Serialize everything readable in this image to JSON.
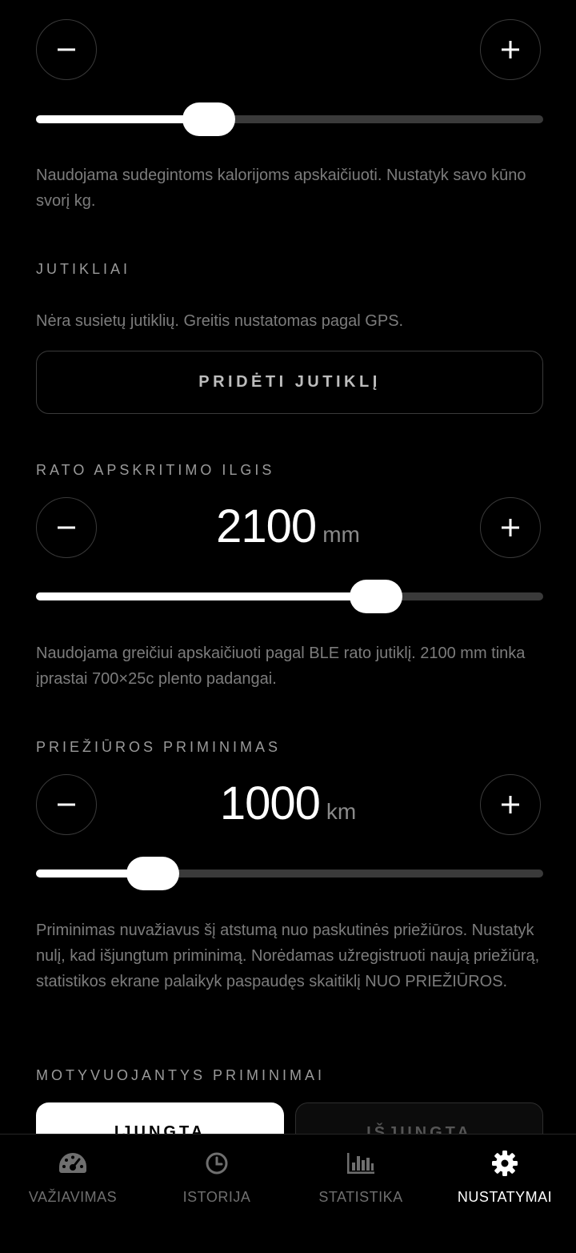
{
  "weight": {
    "slider_fraction": 0.34,
    "description": "Naudojama sudegintoms kalorijoms apskaičiuoti. Nustatyk savo kūno svorį kg."
  },
  "sensors": {
    "title": "JUTIKLIAI",
    "status": "Nėra susietų jutiklių. Greitis nustatomas pagal GPS.",
    "add_button": "PRIDĖTI JUTIKLĮ"
  },
  "wheel": {
    "title": "RATO APSKRITIMO ILGIS",
    "value": "2100",
    "unit": "mm",
    "slider_fraction": 0.67,
    "description": "Naudojama greičiui apskaičiuoti pagal BLE rato jutiklį. 2100 mm tinka įprastai 700×25c plento padangai."
  },
  "service": {
    "title": "PRIEŽIŪROS PRIMINIMAS",
    "value": "1000",
    "unit": "km",
    "slider_fraction": 0.23,
    "description": "Priminimas nuvažiavus šį atstumą nuo paskutinės priežiūros. Nustatyk nulį, kad išjungtum priminimą. Norėdamas užregistruoti naują priežiūrą, statistikos ekrane palaikyk paspaudęs skaitiklį NUO PRIEŽIŪROS."
  },
  "motivation": {
    "title": "MOTYVUOJANTYS PRIMINIMAI",
    "on_label": "ĮJUNGTA",
    "off_label": "IŠJUNGTA"
  },
  "tabs": [
    {
      "label": "VAŽIAVIMAS",
      "icon": "speedometer-icon",
      "active": false
    },
    {
      "label": "ISTORIJA",
      "icon": "clock-icon",
      "active": false
    },
    {
      "label": "STATISTIKA",
      "icon": "bar-chart-icon",
      "active": false
    },
    {
      "label": "NUSTATYMAI",
      "icon": "gear-icon",
      "active": true
    }
  ],
  "colors": {
    "background": "#000000",
    "accent": "#ffffff",
    "muted_text": "#7c7c7c",
    "track": "#3a3a3a"
  }
}
